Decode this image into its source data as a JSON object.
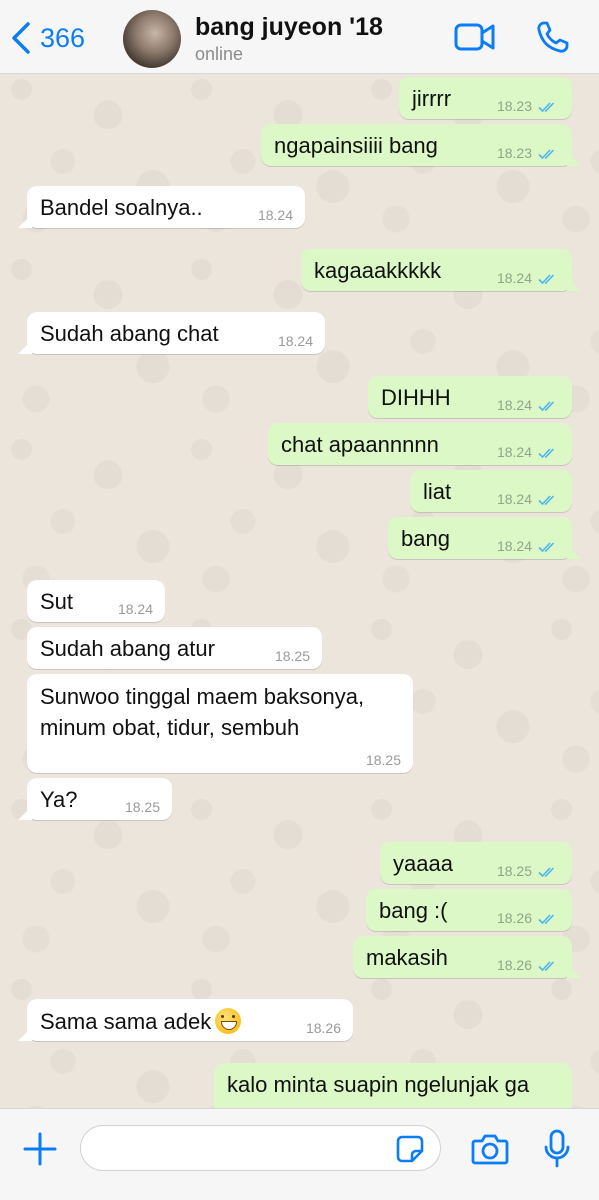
{
  "header": {
    "back_count": "366",
    "contact_name": "bang juyeon '18",
    "status": "online"
  },
  "messages": [
    {
      "dir": "out",
      "text": "jirrrr",
      "time": "18.23"
    },
    {
      "dir": "out",
      "text": "ngapainsiiii bang",
      "time": "18.23"
    },
    {
      "dir": "in",
      "text": "Bandel soalnya..",
      "time": "18.24"
    },
    {
      "dir": "out",
      "text": "kagaaakkkkk",
      "time": "18.24"
    },
    {
      "dir": "in",
      "text": "Sudah abang chat",
      "time": "18.24"
    },
    {
      "dir": "out",
      "text": "DIHHH",
      "time": "18.24"
    },
    {
      "dir": "out",
      "text": "chat apaannnnn",
      "time": "18.24"
    },
    {
      "dir": "out",
      "text": "liat",
      "time": "18.24"
    },
    {
      "dir": "out",
      "text": "bang",
      "time": "18.24"
    },
    {
      "dir": "in",
      "text": "Sut",
      "time": "18.24"
    },
    {
      "dir": "in",
      "text": "Sudah abang atur",
      "time": "18.25"
    },
    {
      "dir": "in",
      "text_line1": "Sunwoo tinggal maem baksonya,",
      "text_line2": "minum obat, tidur, sembuh",
      "time": "18.25"
    },
    {
      "dir": "in",
      "text": "Ya?",
      "time": "18.25"
    },
    {
      "dir": "out",
      "text": "yaaaa",
      "time": "18.25"
    },
    {
      "dir": "out",
      "text": "bang :(",
      "time": "18.26"
    },
    {
      "dir": "out",
      "text": "makasih",
      "time": "18.26"
    },
    {
      "dir": "in",
      "text": "Sama sama adek",
      "emoji": "grinning-face-emoji",
      "time": "18.26"
    },
    {
      "dir": "out",
      "text": "kalo minta suapin ngelunjak ga"
    }
  ],
  "input": {
    "value": ""
  },
  "colors": {
    "accent": "#0b7df5",
    "outgoing_bubble": "#dcf8c6",
    "incoming_bubble": "#ffffff",
    "chat_bg": "#ece5dc",
    "read_ticks": "#4fb6ec"
  }
}
